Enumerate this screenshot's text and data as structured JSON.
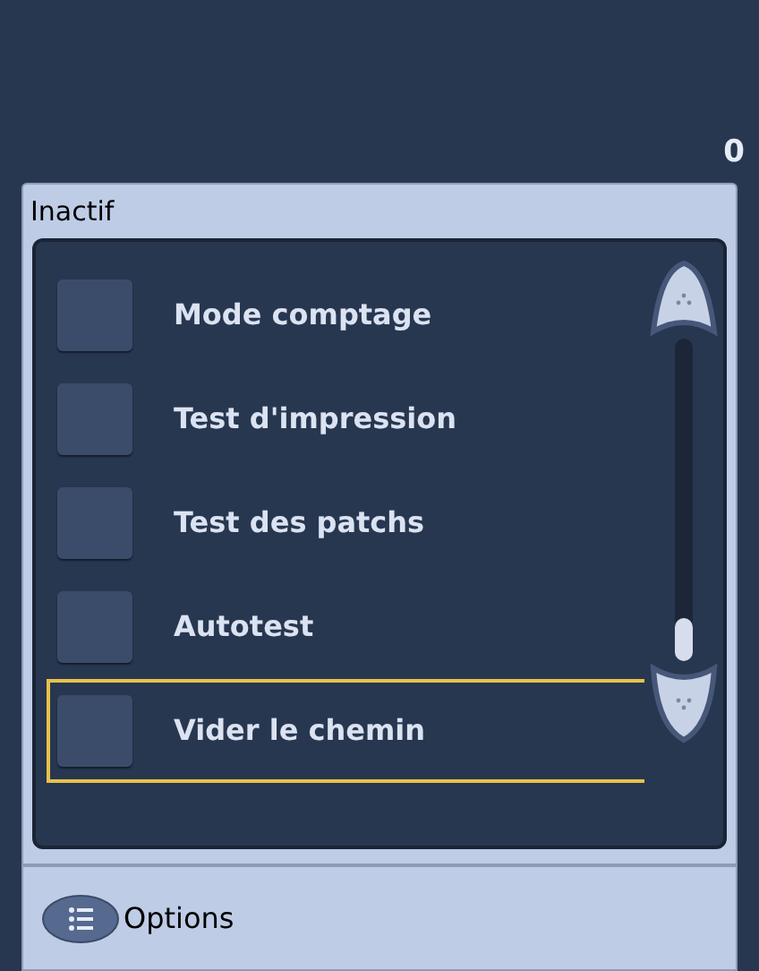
{
  "counter": "0",
  "panel": {
    "title": "Inactif",
    "items": [
      {
        "label": "Mode comptage",
        "checked": false,
        "selected": false
      },
      {
        "label": "Test d'impression",
        "checked": false,
        "selected": false
      },
      {
        "label": "Test des patchs",
        "checked": false,
        "selected": false
      },
      {
        "label": "Autotest",
        "checked": false,
        "selected": false
      },
      {
        "label": "Vider le chemin",
        "checked": false,
        "selected": true
      }
    ]
  },
  "footer": {
    "button": "Options"
  }
}
